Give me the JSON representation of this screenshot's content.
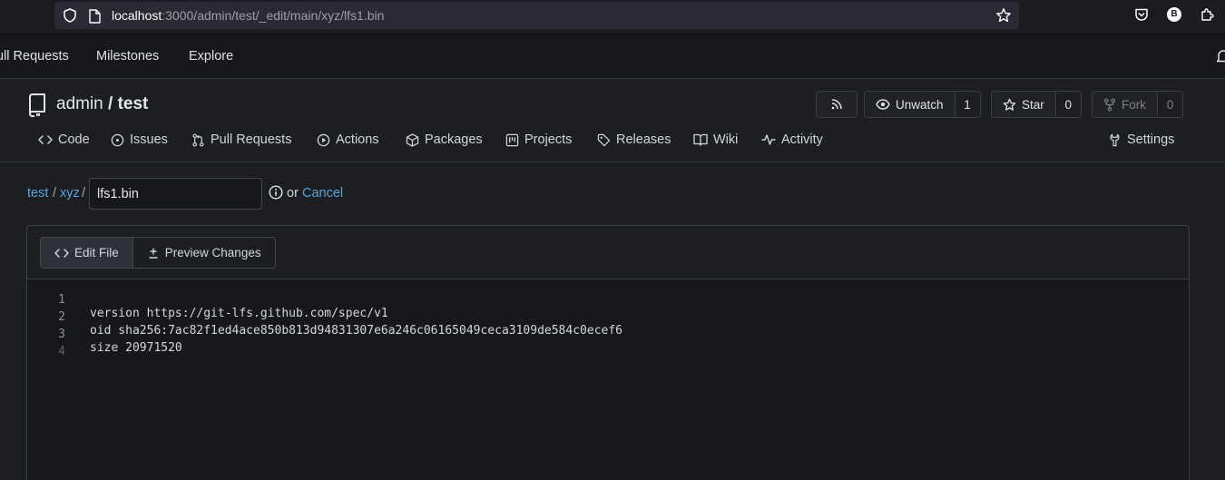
{
  "browser": {
    "url_host": "localhost",
    "url_path": ":3000/admin/test/_edit/main/xyz/lfs1.bin",
    "account_initial": "B"
  },
  "topnav": {
    "items": [
      "ull Requests",
      "Milestones",
      "Explore"
    ]
  },
  "repo": {
    "owner": "admin",
    "separator": "/",
    "name": "test",
    "unwatch_label": "Unwatch",
    "watch_count": "1",
    "star_label": "Star",
    "star_count": "0",
    "fork_label": "Fork",
    "fork_count": "0"
  },
  "tabs": [
    {
      "label": "Code",
      "icon": "code-icon"
    },
    {
      "label": "Issues",
      "icon": "issue-icon"
    },
    {
      "label": "Pull Requests",
      "icon": "pull-request-icon"
    },
    {
      "label": "Actions",
      "icon": "play-icon"
    },
    {
      "label": "Packages",
      "icon": "package-icon"
    },
    {
      "label": "Projects",
      "icon": "project-icon"
    },
    {
      "label": "Releases",
      "icon": "tag-icon"
    },
    {
      "label": "Wiki",
      "icon": "book-icon"
    },
    {
      "label": "Activity",
      "icon": "pulse-icon"
    },
    {
      "label": "Settings",
      "icon": "tools-icon"
    }
  ],
  "path": {
    "crumbs": [
      "test",
      "xyz"
    ],
    "separator": "/",
    "filename": "lfs1.bin",
    "or_text": "or",
    "cancel_label": "Cancel"
  },
  "editor": {
    "edit_tab_label": "Edit File",
    "preview_tab_label": "Preview Changes",
    "lines": [
      {
        "num": "1",
        "text": "version https://git-lfs.github.com/spec/v1"
      },
      {
        "num": "2",
        "text": "oid sha256:7ac82f1ed4ace850b813d94831307e6a246c06165049ceca3109de584c0ecef6"
      },
      {
        "num": "3",
        "text": "size 20971520"
      },
      {
        "num": "4",
        "text": ""
      }
    ]
  },
  "colors": {
    "background": "#1c1e21",
    "link": "#5aa2e0",
    "border": "#3b3f45"
  }
}
